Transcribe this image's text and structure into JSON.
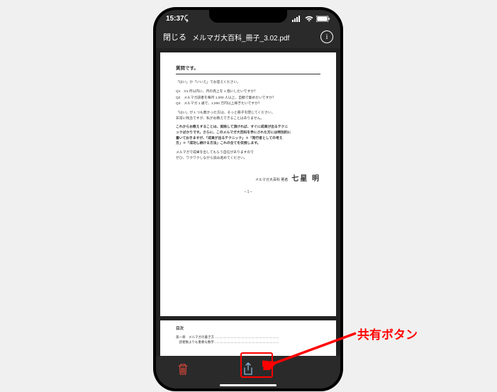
{
  "status": {
    "time": "15:37",
    "watch_glyph": "⤹"
  },
  "nav": {
    "close": "閉じる",
    "title": "メルマガ大百科_冊子_3.02.pdf"
  },
  "doc": {
    "heading": "質問です。",
    "instr1": "「はい」か「いいえ」でお答えください。",
    "q1": "Q1　3ヶ月以内に、月の売上を 1 億にしたいですか？",
    "q2": "Q2　メルマガ読者を毎月 1,000 人以上、自動で集めたいですか？",
    "q3": "Q3　メルマガ 1 通で、1,000 万円以上稼ぎたいですか？",
    "p1": "「はい」が 1 つも無かった方は、そっと冊子を閉じてください。",
    "p1b": "非常に残念ですが、私がお教えできることはありません。",
    "p2a": "これからお教えすることは、実践して頂ければ、すぐに成果が出るテクニ",
    "p2b": "ックばかりです。さらに、このメルマガ大百科を手にされた方には特別的に",
    "p2c": "書いておきますが、「成果が出るテクニック」＋「発行者としての考え",
    "p2d": "方」＋「成功し続ける方法」これの全てを伝授します。",
    "p3a": "メルマガで成果を出してもらう自信がありますので",
    "p3b": "ぜひ、ワクワクしながら読み進めてください。",
    "author_pre": "メルマガ大百科 著者",
    "author_name": "七星 明",
    "pagenum": "– 1 –",
    "toc": "目次",
    "toc1": "第一章　メルマガの書き方 ........................................................................",
    "toc2": "　読者数よりも重要な数字 ........................................................................"
  },
  "annotation": {
    "label": "共有ボタン"
  }
}
